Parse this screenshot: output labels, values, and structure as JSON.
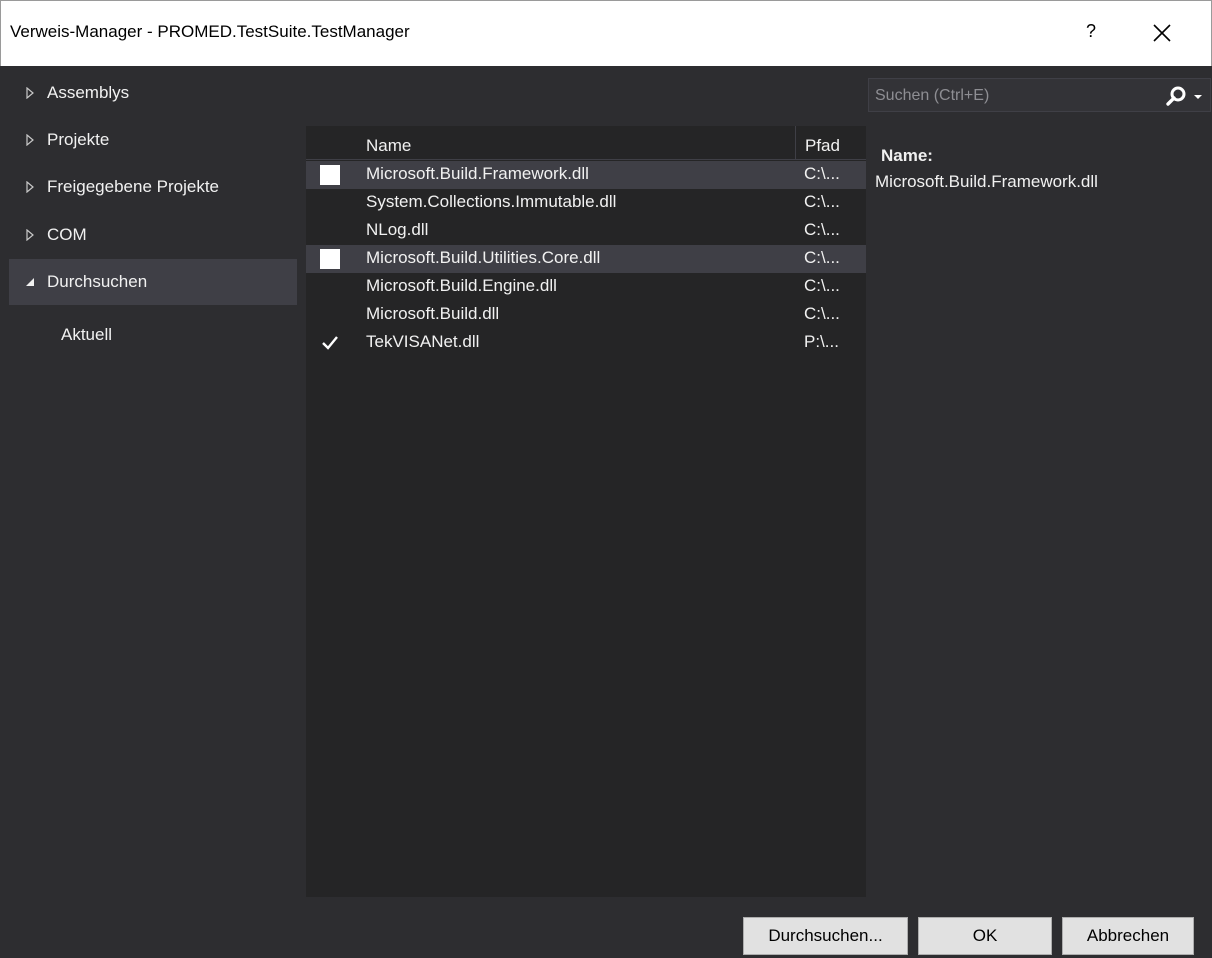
{
  "window": {
    "title": "Verweis-Manager - PROMED.TestSuite.TestManager",
    "help_label": "?"
  },
  "nav": {
    "items": [
      {
        "label": "Assemblys",
        "expanded": false,
        "selected": false
      },
      {
        "label": "Projekte",
        "expanded": false,
        "selected": false
      },
      {
        "label": "Freigegebene Projekte",
        "expanded": false,
        "selected": false
      },
      {
        "label": "COM",
        "expanded": false,
        "selected": false
      },
      {
        "label": "Durchsuchen",
        "expanded": true,
        "selected": true
      }
    ],
    "subitems": [
      {
        "label": "Aktuell"
      }
    ]
  },
  "search": {
    "placeholder": "Suchen (Ctrl+E)",
    "icon": "search-icon"
  },
  "list": {
    "columns": {
      "name": "Name",
      "path": "Pfad"
    },
    "rows": [
      {
        "name": "Microsoft.Build.Framework.dll",
        "path": "C:\\...",
        "checkbox": "unchecked",
        "highlighted": true
      },
      {
        "name": "System.Collections.Immutable.dll",
        "path": "C:\\...",
        "checkbox": "none",
        "highlighted": false
      },
      {
        "name": "NLog.dll",
        "path": "C:\\...",
        "checkbox": "none",
        "highlighted": false
      },
      {
        "name": "Microsoft.Build.Utilities.Core.dll",
        "path": "C:\\...",
        "checkbox": "unchecked",
        "highlighted": true
      },
      {
        "name": "Microsoft.Build.Engine.dll",
        "path": "C:\\...",
        "checkbox": "none",
        "highlighted": false
      },
      {
        "name": "Microsoft.Build.dll",
        "path": "C:\\...",
        "checkbox": "none",
        "highlighted": false
      },
      {
        "name": "TekVISANet.dll",
        "path": "P:\\...",
        "checkbox": "checked",
        "highlighted": false
      }
    ]
  },
  "details": {
    "label": "Name:",
    "value": "Microsoft.Build.Framework.dll"
  },
  "footer": {
    "browse_label": "Durchsuchen...",
    "ok_label": "OK",
    "cancel_label": "Abbrechen"
  },
  "colors": {
    "background": "#2d2d30",
    "list_background": "#252526",
    "highlight": "#3f3f46",
    "text": "#f1f1f1"
  }
}
